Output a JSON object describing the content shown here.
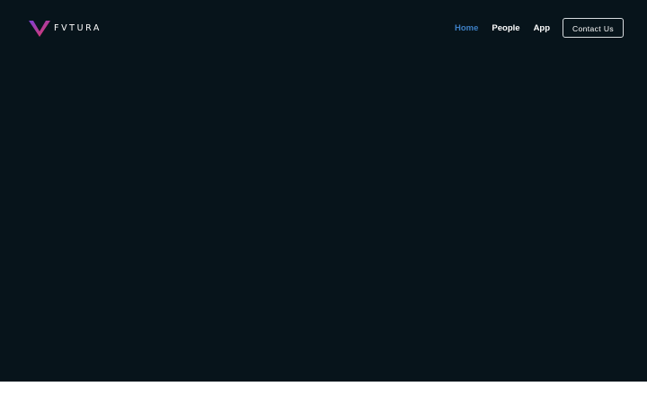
{
  "brand": {
    "name": "FVTURA",
    "logo_icon": "v-chevron-logo-icon",
    "logo_gradient": [
      "#7b3fd6",
      "#e8385e"
    ]
  },
  "nav": {
    "links": [
      {
        "label": "Home",
        "active": true
      },
      {
        "label": "People",
        "active": false
      },
      {
        "label": "App",
        "active": false
      }
    ],
    "active_color": "#3d7fc4",
    "contact_label": "Contact Us"
  },
  "colors": {
    "hero_background": "#07141b",
    "page_background": "#ffffff",
    "text": "#ffffff"
  }
}
